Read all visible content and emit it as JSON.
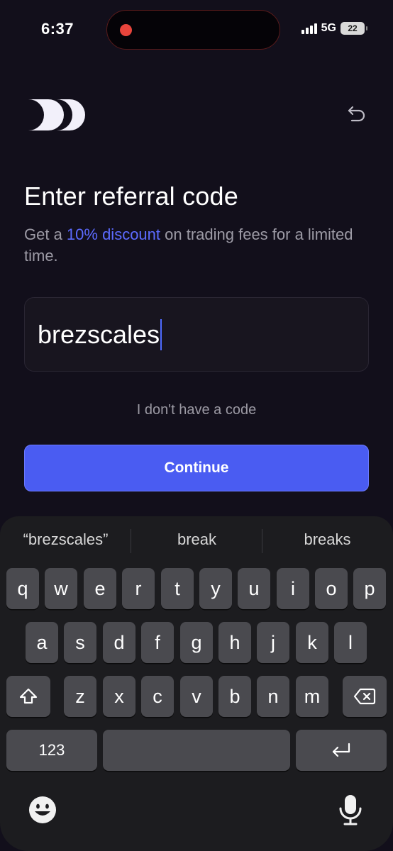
{
  "status_bar": {
    "time": "6:37",
    "network": "5G",
    "battery": "22"
  },
  "header": {
    "logo_icon": "brand-logo-icon",
    "back_icon": "undo-arrow-icon"
  },
  "main": {
    "title": "Enter referral code",
    "subtitle_before": "Get a ",
    "subtitle_accent": "10% discount",
    "subtitle_after": " on trading fees for a limited time.",
    "code_value": "brezscales",
    "no_code_label": "I don't have a code",
    "continue_label": "Continue",
    "accent_color": "#4a5cf2"
  },
  "keyboard": {
    "suggestions": [
      "“brezscales”",
      "break",
      "breaks"
    ],
    "row1": [
      "q",
      "w",
      "e",
      "r",
      "t",
      "y",
      "u",
      "i",
      "o",
      "p"
    ],
    "row2": [
      "a",
      "s",
      "d",
      "f",
      "g",
      "h",
      "j",
      "k",
      "l"
    ],
    "row3": [
      "z",
      "x",
      "c",
      "v",
      "b",
      "n",
      "m"
    ],
    "numbers_label": "123",
    "shift_icon": "shift-icon",
    "delete_icon": "backspace-icon",
    "return_icon": "return-icon",
    "emoji_icon": "emoji-icon",
    "mic_icon": "microphone-icon"
  }
}
